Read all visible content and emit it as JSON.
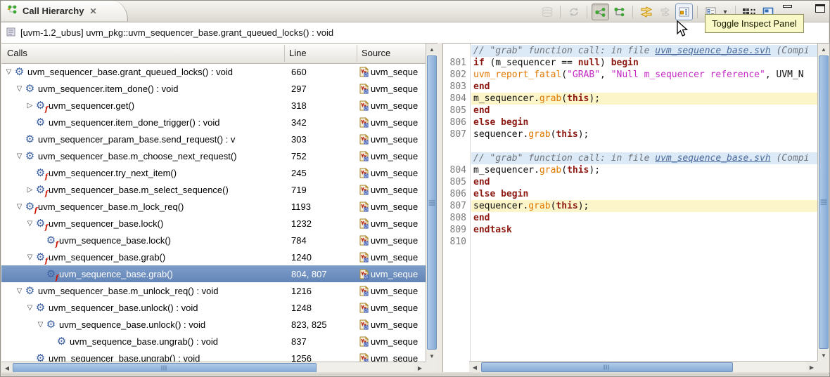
{
  "tab": {
    "title": "Call Hierarchy",
    "close": "✕"
  },
  "toolbar": {
    "tooltip": "Toggle Inspect Panel",
    "items": [
      {
        "icon": "stack-icon",
        "state": "disabled"
      },
      {
        "sep": true
      },
      {
        "icon": "refresh-icon",
        "state": "disabled"
      },
      {
        "sep": true
      },
      {
        "icon": "caller-hierarchy-icon",
        "state": "pressed"
      },
      {
        "icon": "callee-hierarchy-icon",
        "state": "normal"
      },
      {
        "sep": true
      },
      {
        "icon": "swap-arrows-icon",
        "state": "normal"
      },
      {
        "icon": "double-arrow-icon",
        "state": "disabled"
      },
      {
        "icon": "inspect-panel-icon",
        "state": "hover"
      },
      {
        "sep": true
      },
      {
        "icon": "view-menu-icon",
        "state": "normal"
      },
      {
        "icon": "chevron-down-icon",
        "state": "chevron"
      },
      {
        "sep": true
      },
      {
        "icon": "fields-icon",
        "state": "normal"
      },
      {
        "icon": "maximize-view-icon",
        "state": "normal"
      }
    ]
  },
  "header": {
    "text": "[uvm-1.2_ubus] uvm_pkg::uvm_sequencer_base.grant_queued_locks() : void"
  },
  "tree": {
    "columns": [
      "Calls",
      "Line",
      "Source"
    ],
    "source_text": "uvm_seque",
    "rows": [
      {
        "label": "uvm_sequencer_base.grant_queued_locks() : void",
        "line": "660",
        "depth": 0,
        "exp": "open",
        "flag": false,
        "selected": false
      },
      {
        "label": "uvm_sequencer.item_done() : void",
        "line": "297",
        "depth": 1,
        "exp": "open",
        "flag": false,
        "selected": false
      },
      {
        "label": "uvm_sequencer.get()",
        "line": "318",
        "depth": 2,
        "exp": "closed",
        "flag": true,
        "selected": false
      },
      {
        "label": "uvm_sequencer.item_done_trigger() : void",
        "line": "342",
        "depth": 2,
        "exp": "none",
        "flag": false,
        "selected": false
      },
      {
        "label": "uvm_sequencer_param_base.send_request() : v",
        "line": "303",
        "depth": 1,
        "exp": "none",
        "flag": false,
        "selected": false
      },
      {
        "label": "uvm_sequencer_base.m_choose_next_request()",
        "line": "752",
        "depth": 1,
        "exp": "open",
        "flag": false,
        "selected": false
      },
      {
        "label": "uvm_sequencer.try_next_item()",
        "line": "245",
        "depth": 2,
        "exp": "none",
        "flag": true,
        "selected": false
      },
      {
        "label": "uvm_sequencer_base.m_select_sequence()",
        "line": "719",
        "depth": 2,
        "exp": "closed",
        "flag": true,
        "selected": false
      },
      {
        "label": "uvm_sequencer_base.m_lock_req()",
        "line": "1193",
        "depth": 1,
        "exp": "open",
        "flag": true,
        "selected": false
      },
      {
        "label": "uvm_sequencer_base.lock()",
        "line": "1232",
        "depth": 2,
        "exp": "open",
        "flag": true,
        "selected": false
      },
      {
        "label": "uvm_sequence_base.lock()",
        "line": "784",
        "depth": 3,
        "exp": "none",
        "flag": true,
        "selected": false
      },
      {
        "label": "uvm_sequencer_base.grab()",
        "line": "1240",
        "depth": 2,
        "exp": "open",
        "flag": true,
        "selected": false
      },
      {
        "label": "uvm_sequence_base.grab()",
        "line": "804, 807",
        "depth": 3,
        "exp": "none",
        "flag": true,
        "selected": true
      },
      {
        "label": "uvm_sequencer_base.m_unlock_req() : void",
        "line": "1216",
        "depth": 1,
        "exp": "open",
        "flag": false,
        "selected": false
      },
      {
        "label": "uvm_sequencer_base.unlock() : void",
        "line": "1248",
        "depth": 2,
        "exp": "open",
        "flag": false,
        "selected": false
      },
      {
        "label": "uvm_sequence_base.unlock() : void",
        "line": "823, 825",
        "depth": 3,
        "exp": "open",
        "flag": false,
        "selected": false
      },
      {
        "label": "uvm_sequence_base.ungrab() : void",
        "line": "837",
        "depth": 4,
        "exp": "none",
        "flag": false,
        "selected": false
      },
      {
        "label": "uvm_sequencer_base.ungrab() : void",
        "line": "1256",
        "depth": 2,
        "exp": "none",
        "flag": false,
        "selected": false
      }
    ]
  },
  "code": {
    "lines": [
      {
        "type": "header",
        "segments": [
          [
            "cmt",
            "// \"grab\" function call: in file "
          ],
          [
            "lnk",
            "uvm_sequence_base.svh"
          ],
          [
            "cmt",
            " (Compi"
          ]
        ]
      },
      {
        "num": "801",
        "segments": [
          [
            "kw",
            "if"
          ],
          [
            "pl",
            " (m_sequencer == "
          ],
          [
            "kw",
            "null"
          ],
          [
            "pl",
            ") "
          ],
          [
            "kw",
            "begin"
          ]
        ]
      },
      {
        "num": "802",
        "segments": [
          [
            "pl",
            "  "
          ],
          [
            "fn",
            "uvm_report_fatal"
          ],
          [
            "pl",
            "("
          ],
          [
            "str",
            "\"GRAB\""
          ],
          [
            "pl",
            ", "
          ],
          [
            "str",
            "\"Null m_sequencer reference\""
          ],
          [
            "pl",
            ", UVM_N"
          ]
        ]
      },
      {
        "num": "803",
        "segments": [
          [
            "kw",
            "end"
          ]
        ]
      },
      {
        "num": "804",
        "hl": true,
        "segments": [
          [
            "pl",
            "m_sequencer."
          ],
          [
            "fn",
            "grab"
          ],
          [
            "pl",
            "("
          ],
          [
            "kw",
            "this"
          ],
          [
            "pl",
            ");"
          ]
        ]
      },
      {
        "num": "805",
        "segments": [
          [
            "kw",
            "end"
          ]
        ]
      },
      {
        "num": "806",
        "segments": [
          [
            "kw",
            "else"
          ],
          [
            "pl",
            " "
          ],
          [
            "kw",
            "begin"
          ]
        ]
      },
      {
        "num": "807",
        "segments": [
          [
            "pl",
            "sequencer."
          ],
          [
            "fn",
            "grab"
          ],
          [
            "pl",
            "("
          ],
          [
            "kw",
            "this"
          ],
          [
            "pl",
            ");"
          ]
        ]
      },
      {
        "type": "blank",
        "segments": []
      },
      {
        "type": "header",
        "segments": [
          [
            "cmt",
            "// \"grab\" function call: in file "
          ],
          [
            "lnk",
            "uvm_sequence_base.svh"
          ],
          [
            "cmt",
            " (Compi"
          ]
        ]
      },
      {
        "num": "804",
        "segments": [
          [
            "pl",
            "m_sequencer."
          ],
          [
            "fn",
            "grab"
          ],
          [
            "pl",
            "("
          ],
          [
            "kw",
            "this"
          ],
          [
            "pl",
            ");"
          ]
        ]
      },
      {
        "num": "805",
        "segments": [
          [
            "kw",
            "end"
          ]
        ]
      },
      {
        "num": "806",
        "segments": [
          [
            "kw",
            "else"
          ],
          [
            "pl",
            " "
          ],
          [
            "kw",
            "begin"
          ]
        ]
      },
      {
        "num": "807",
        "hl": true,
        "segments": [
          [
            "pl",
            "sequencer."
          ],
          [
            "fn",
            "grab"
          ],
          [
            "pl",
            "("
          ],
          [
            "kw",
            "this"
          ],
          [
            "pl",
            ");"
          ]
        ]
      },
      {
        "num": "808",
        "segments": [
          [
            "kw",
            "end"
          ]
        ]
      },
      {
        "num": "809",
        "segments": [
          [
            "kw",
            "endtask"
          ]
        ]
      },
      {
        "num": "810",
        "segments": []
      }
    ]
  },
  "colors": {
    "selection": "#6F93C2",
    "code_keyword": "#8D1A12",
    "code_function": "#E07800",
    "code_string": "#C428C4",
    "code_comment": "#70757B",
    "code_link": "#4A6B9B",
    "line_number": "#7B7B7B",
    "header_band": "#DCE9F7",
    "call_highlight": "#FBF5C9",
    "tooltip_bg": "#F9F9C8",
    "tooltip_border": "#90905C",
    "gear_blue": "#3A5F9F",
    "flag_red": "#CC1100",
    "icon_green": "#3FA535",
    "gold": "#C79100"
  }
}
